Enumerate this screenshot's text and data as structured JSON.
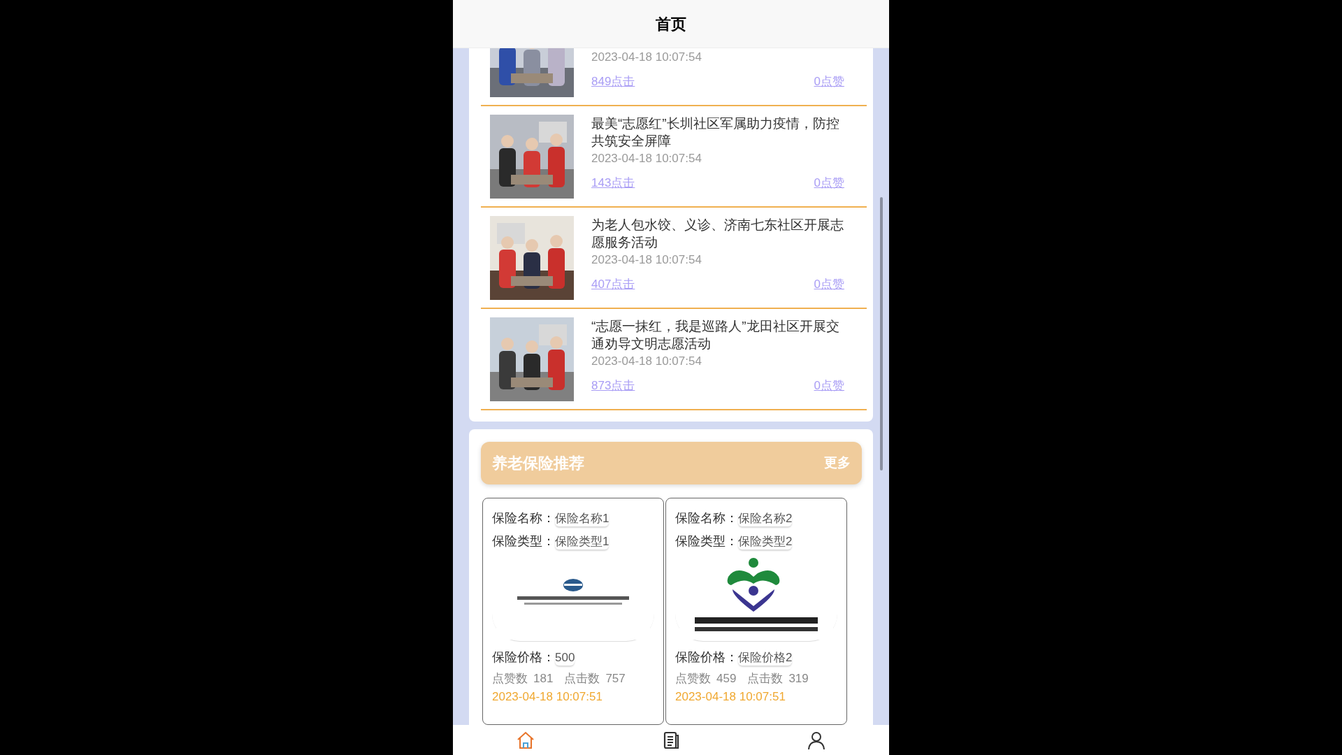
{
  "header": {
    "title": "首页"
  },
  "news": [
    {
      "date": "2023-04-18 10:07:54",
      "clicks": "849点击",
      "likes": "0点赞"
    },
    {
      "title": "最美“志愿红”长圳社区军属助力疫情，防控共筑安全屏障",
      "date": "2023-04-18 10:07:54",
      "clicks": "143点击",
      "likes": "0点赞"
    },
    {
      "title": "为老人包水饺、义诊、济南七东社区开展志愿服务活动",
      "date": "2023-04-18 10:07:54",
      "clicks": "407点击",
      "likes": "0点赞"
    },
    {
      "title": "“志愿一抹红，我是巡路人”龙田社区开展交通劝导文明志愿活动",
      "date": "2023-04-18 10:07:54",
      "clicks": "873点击",
      "likes": "0点赞"
    }
  ],
  "insurance": {
    "title": "养老保险推荐",
    "more": "更多",
    "items": [
      {
        "name_label": "保险名称：",
        "name": "保险名称1",
        "type_label": "保险类型：",
        "type": "保险类型1",
        "price_label": "保险价格：",
        "price": "500",
        "likes_label": "点赞数",
        "likes": "181",
        "clicks_label": "点击数",
        "clicks": "757",
        "date": "2023-04-18 10:07:51"
      },
      {
        "name_label": "保险名称：",
        "name": "保险名称2",
        "type_label": "保险类型：",
        "type": "保险类型2",
        "price_label": "保险价格：",
        "price": "保险价格2",
        "likes_label": "点赞数",
        "likes": "459",
        "clicks_label": "点击数",
        "clicks": "319",
        "date": "2023-04-18 10:07:51"
      }
    ]
  },
  "tab_bar": [
    {
      "selected": true
    },
    {
      "selected": false
    },
    {
      "selected": false
    }
  ]
}
